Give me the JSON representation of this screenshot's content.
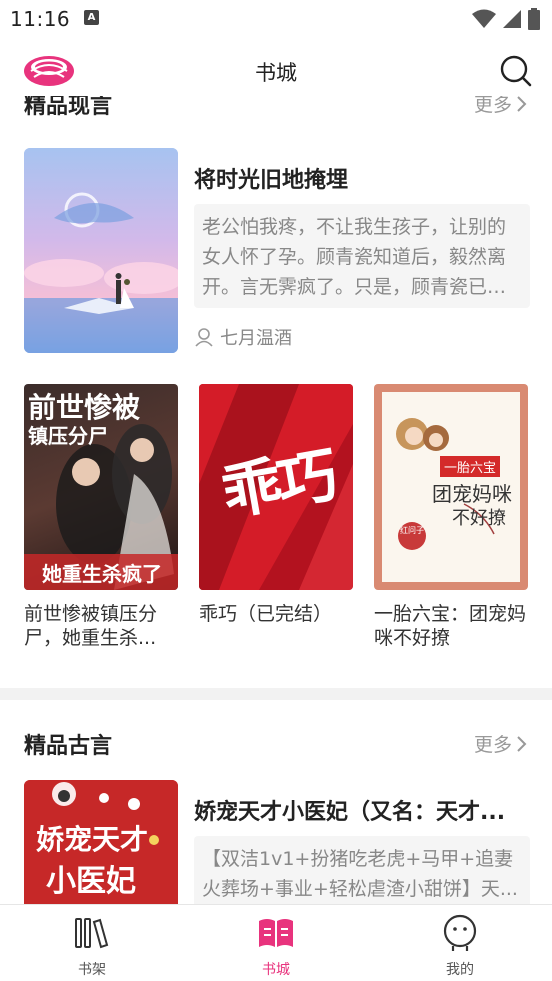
{
  "status_bar": {
    "time": "11:16",
    "notification_letter": "A"
  },
  "header": {
    "title": "书城"
  },
  "section1": {
    "title": "精品现言",
    "more_label": "更多",
    "featured": {
      "title": "将时光旧地掩埋",
      "description": "老公怕我疼，不让我生孩子，让别的女人怀了孕。顾青瓷知道后，毅然离开。言无霁疯了。只是，顾青瓷已经...",
      "author": "七月温酒"
    },
    "books": [
      {
        "title": "前世惨被镇压分尸，她重生杀...",
        "cover_text_top": "前世惨被",
        "cover_text_mid": "镇压分尸",
        "cover_text_bottom": "她重生杀疯了"
      },
      {
        "title": "乖巧（已完结）",
        "cover_text": "乖巧"
      },
      {
        "title": "一胎六宝：团宠妈咪不好撩",
        "cover_text_top": "一胎六宝",
        "cover_text_mid": "团宠妈咪",
        "cover_text_bottom": "不好撩",
        "cover_stamp": "红问子"
      }
    ]
  },
  "section2": {
    "title": "精品古言",
    "more_label": "更多",
    "featured": {
      "title": "娇宠天才小医妃（又名：天才...",
      "description": "【双洁1v1+扮猪吃老虎+马甲+追妻火葬场+事业+轻松虐渣小甜饼】天...",
      "cover_text_1": "娇宠天才",
      "cover_text_2": "小医妃"
    }
  },
  "bottom_nav": [
    {
      "label": "书架",
      "icon": "bookshelf-icon",
      "active": false
    },
    {
      "label": "书城",
      "icon": "bookstore-icon",
      "active": true
    },
    {
      "label": "我的",
      "icon": "profile-icon",
      "active": false
    }
  ],
  "colors": {
    "accent": "#e8337d",
    "text": "#222222",
    "muted": "#888888"
  }
}
